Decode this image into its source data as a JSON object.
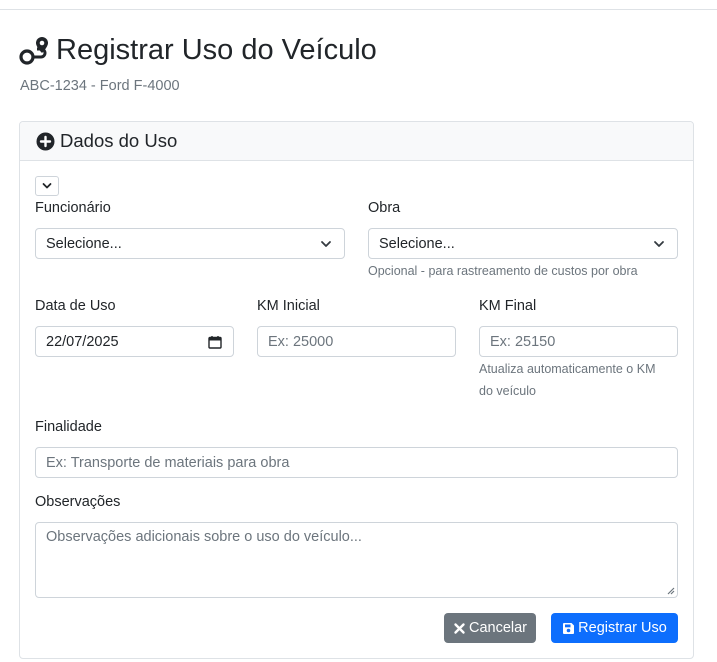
{
  "page": {
    "title": "Registrar Uso do Veículo",
    "subtitle": "ABC-1234 - Ford F-4000",
    "title_icon": "route-icon"
  },
  "card": {
    "header": "Dados do Uso",
    "header_icon": "plus-circle-icon"
  },
  "form": {
    "funcionario": {
      "label": "Funcionário",
      "value": "Selecione..."
    },
    "obra": {
      "label": "Obra",
      "value": "Selecione...",
      "help": "Opcional - para rastreamento de custos por obra"
    },
    "data_uso": {
      "label": "Data de Uso",
      "value": "22/07/2025"
    },
    "km_inicial": {
      "label": "KM Inicial",
      "placeholder": "Ex: 25000"
    },
    "km_final": {
      "label": "KM Final",
      "placeholder": "Ex: 25150",
      "help_line1": "Atualiza automaticamente o KM",
      "help_line2": "do veículo"
    },
    "finalidade": {
      "label": "Finalidade",
      "placeholder": "Ex: Transporte de materiais para obra"
    },
    "observacoes": {
      "label": "Observações",
      "placeholder": "Observações adicionais sobre o uso do veículo..."
    }
  },
  "buttons": {
    "cancel": "Cancelar",
    "submit": "Registrar Uso"
  },
  "colors": {
    "primary": "#0d6efd",
    "secondary": "#6c757d",
    "muted": "#6c757d"
  }
}
